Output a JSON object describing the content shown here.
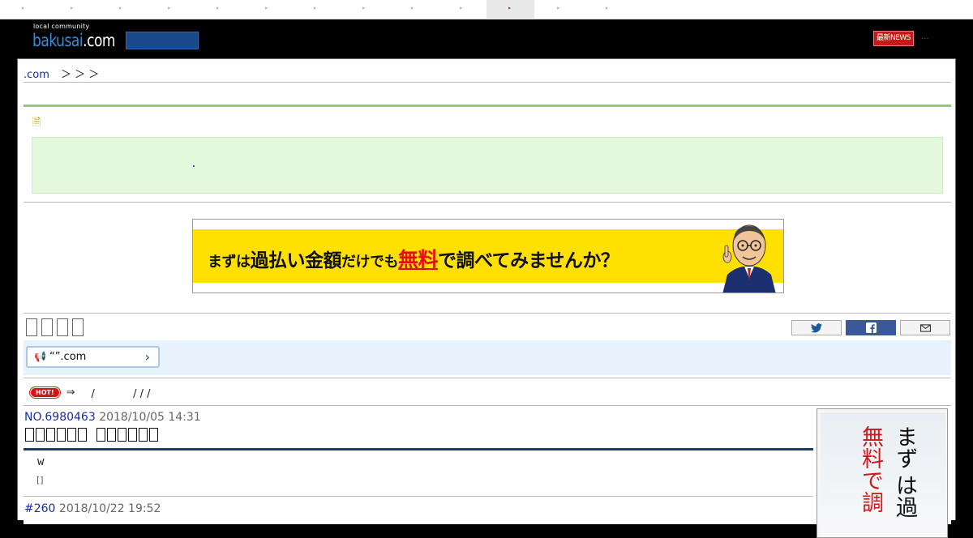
{
  "nav": {
    "ticks": [
      "‣",
      "‣",
      "‣",
      "‣",
      "‣",
      "‣",
      "‣",
      "‣",
      "‣",
      "‣",
      "‣",
      "‣",
      "‣"
    ]
  },
  "header": {
    "logo_small": "local community",
    "logo_brand": "bakusai",
    "logo_dotcom": ".com",
    "news_badge": "最新NEWS",
    "news_more": "..."
  },
  "breadcrumb": {
    "home": ".com",
    "separators": "＞ ＞ ＞"
  },
  "green_box": {
    "dot": "."
  },
  "ad_banner": {
    "part1": "まずは",
    "part2": "過払い金額",
    "part3": "だけでも",
    "part4": "無料",
    "part5": "で調べてみませんか？"
  },
  "notice": {
    "text": "“”.com",
    "chevron": "›"
  },
  "hot_row": {
    "badge": "HOT!",
    "arrow": "⇒",
    "items": "/ 　　　 / / /"
  },
  "post": {
    "number": "NO.6980463",
    "datetime": "2018/10/05 14:31",
    "body": "w",
    "link": "[]"
  },
  "reply": {
    "number": "#260",
    "datetime": "2018/10/22 19:52"
  },
  "side_ad": {
    "col1": "まず",
    "col2": "は過",
    "col3": "無料で調"
  },
  "colors": {
    "accent_blue": "#1a2ea0",
    "green_line": "#94c77a",
    "hot_red": "#d01818",
    "fb_blue": "#3b5998"
  }
}
